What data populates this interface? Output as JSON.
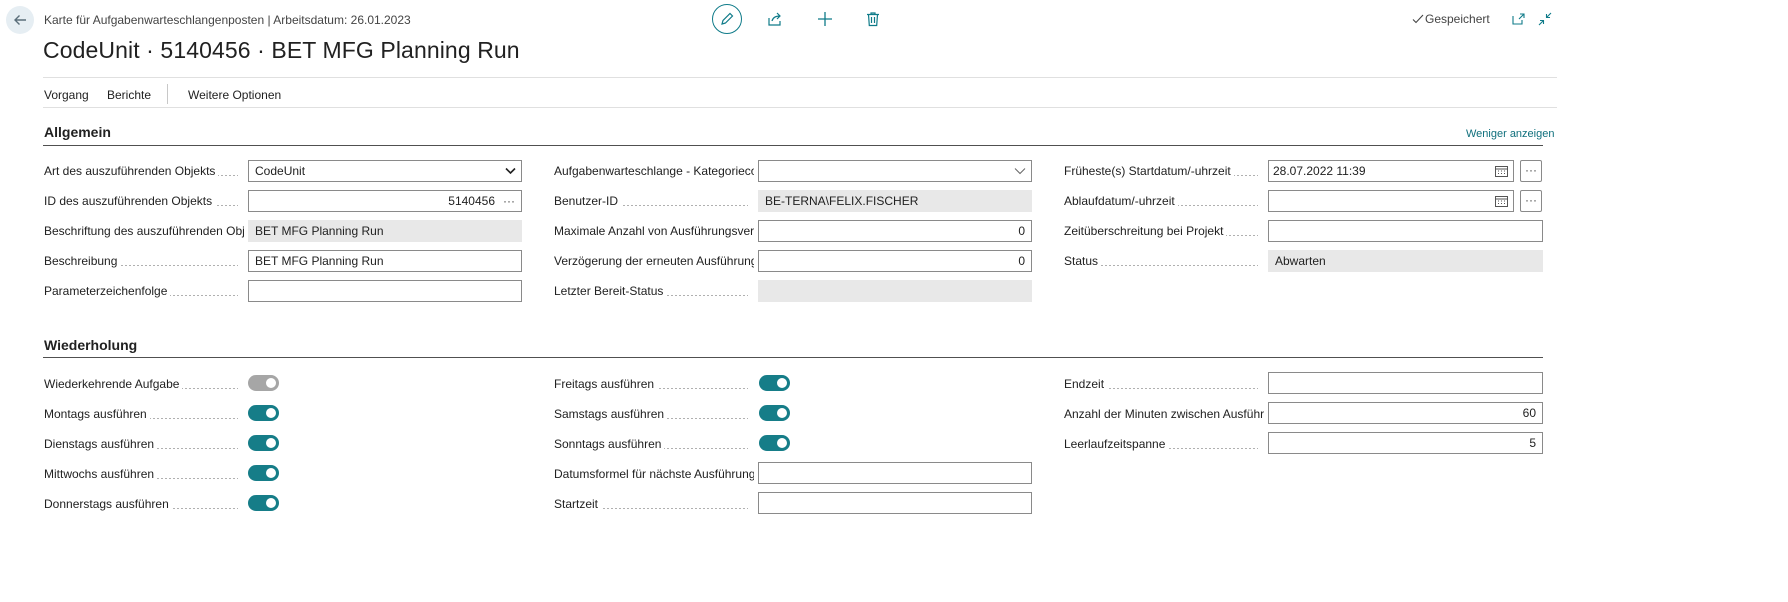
{
  "header": {
    "breadcrumb": "Karte für Aufgabenwarteschlangenposten | Arbeitsdatum: 26.01.2023",
    "title": "CodeUnit · 5140456 · BET MFG Planning Run",
    "saved_status": "Gespeichert"
  },
  "toolbar_icons": [
    "edit-icon",
    "share-icon",
    "new-icon",
    "delete-icon",
    "open-in-new-window-icon",
    "collapse-icon"
  ],
  "actions": {
    "vorgang": "Vorgang",
    "berichte": "Berichte",
    "weitere": "Weitere Optionen"
  },
  "allgemein": {
    "title": "Allgemein",
    "toggle_link": "Weniger anzeigen",
    "col1": [
      {
        "label": "Art des auszuführenden Objekts",
        "value": "CodeUnit"
      },
      {
        "label": "ID des auszuführenden Objekts",
        "value": "5140456"
      },
      {
        "label": "Beschriftung des auszuführenden Objekts",
        "value": "BET MFG Planning Run"
      },
      {
        "label": "Beschreibung",
        "value": "BET MFG Planning Run"
      },
      {
        "label": "Parameterzeichenfolge",
        "value": ""
      }
    ],
    "col2": [
      {
        "label": "Aufgabenwarteschlange - Kategoriecode",
        "value": ""
      },
      {
        "label": "Benutzer-ID",
        "value": "BE-TERNA\\FELIX.FISCHER"
      },
      {
        "label": "Maximale Anzahl von Ausführungsversuchen",
        "value": "0"
      },
      {
        "label": "Verzögerung der erneuten Ausführung (Sek.)",
        "value": "0"
      },
      {
        "label": "Letzter Bereit-Status",
        "value": ""
      }
    ],
    "col3": [
      {
        "label": "Früheste(s) Startdatum/-uhrzeit",
        "value": "28.07.2022 11:39"
      },
      {
        "label": "Ablaufdatum/-uhrzeit",
        "value": ""
      },
      {
        "label": "Zeitüberschreitung bei Projekt",
        "value": ""
      },
      {
        "label": "Status",
        "value": "Abwarten"
      }
    ],
    "assist_button": "···"
  },
  "wiederholung": {
    "title": "Wiederholung",
    "col1": [
      {
        "label": "Wiederkehrende Aufgabe",
        "checked": true,
        "enabled": false
      },
      {
        "label": "Montags ausführen",
        "checked": true,
        "enabled": true
      },
      {
        "label": "Dienstags ausführen",
        "checked": true,
        "enabled": true
      },
      {
        "label": "Mittwochs ausführen",
        "checked": true,
        "enabled": true
      },
      {
        "label": "Donnerstags ausführen",
        "checked": true,
        "enabled": true
      }
    ],
    "col2": [
      {
        "label": "Freitags ausführen",
        "checked": true
      },
      {
        "label": "Samstags ausführen",
        "checked": true
      },
      {
        "label": "Sonntags ausführen",
        "checked": true
      },
      {
        "label": "Datumsformel für nächste Ausführung",
        "value": ""
      },
      {
        "label": "Startzeit",
        "value": ""
      }
    ],
    "col3": [
      {
        "label": "Endzeit",
        "value": ""
      },
      {
        "label": "Anzahl der Minuten zwischen Ausführungen",
        "value": "60"
      },
      {
        "label": "Leerlaufzeitspanne",
        "value": "5"
      }
    ]
  }
}
